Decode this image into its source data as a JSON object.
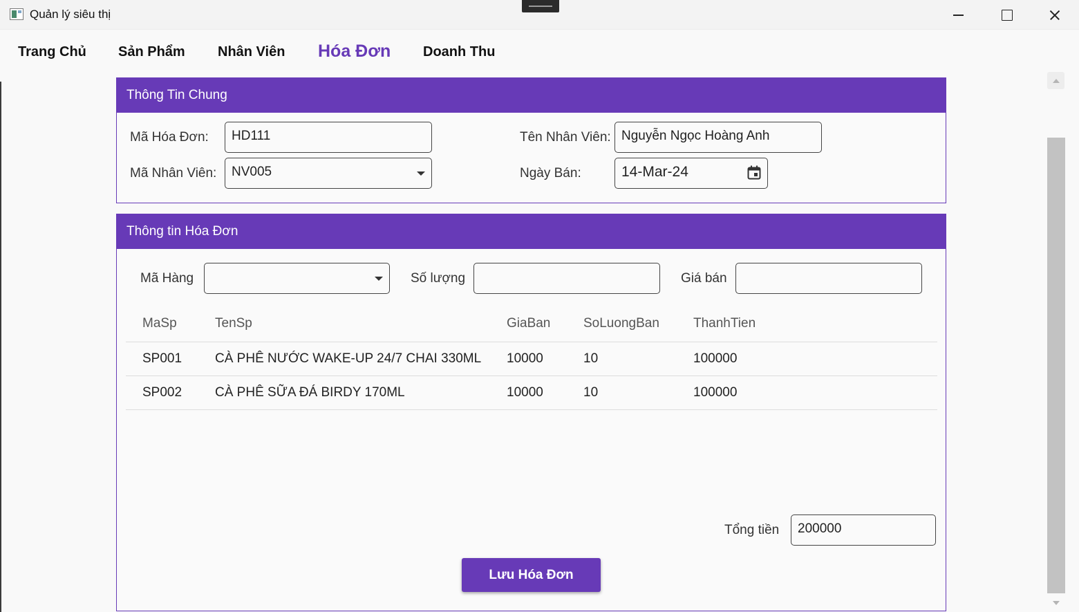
{
  "window": {
    "title": "Quản lý siêu thị"
  },
  "nav": {
    "items": [
      {
        "label": "Trang Chủ"
      },
      {
        "label": "Sản Phẩm"
      },
      {
        "label": "Nhân Viên"
      },
      {
        "label": "Hóa Đơn",
        "active": true
      },
      {
        "label": "Doanh Thu"
      }
    ]
  },
  "general_info": {
    "header": "Thông Tin Chung",
    "invoice_id_label": "Mã Hóa Đơn:",
    "invoice_id_value": "HD111",
    "employee_name_label": "Tên Nhân Viên:",
    "employee_name_value": "Nguyễn Ngọc Hoàng Anh",
    "employee_id_label": "Mã Nhân Viên:",
    "employee_id_value": "NV005",
    "sale_date_label": "Ngày Bán:",
    "sale_date_value": "14-Mar-24"
  },
  "invoice_info": {
    "header": "Thông tin Hóa Đơn",
    "product_code_label": "Mã Hàng",
    "product_code_value": "",
    "quantity_label": "Số lượng",
    "quantity_value": "",
    "price_label": "Giá bán",
    "price_value": "",
    "table": {
      "columns": [
        "MaSp",
        "TenSp",
        "GiaBan",
        "SoLuongBan",
        "ThanhTien"
      ],
      "rows": [
        [
          "SP001",
          "CÀ PHÊ NƯỚC WAKE-UP 24/7 CHAI 330ML",
          "10000",
          "10",
          "100000"
        ],
        [
          "SP002",
          "CÀ PHÊ SỮA ĐÁ BIRDY 170ML",
          "10000",
          "10",
          "100000"
        ]
      ]
    },
    "total_label": "Tổng tiền",
    "total_value": "200000",
    "save_button": "Lưu Hóa Đơn"
  },
  "colors": {
    "accent": "#673ab7"
  }
}
